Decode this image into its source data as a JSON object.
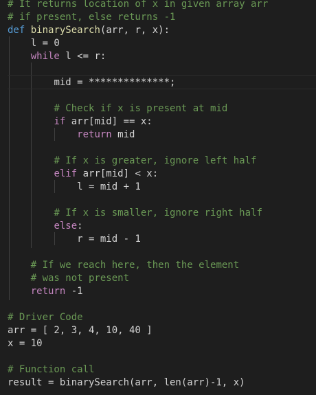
{
  "editor": {
    "lines": [
      {
        "c": "# It returns location of x in given array arr"
      },
      {
        "c": "# if present, else returns -1"
      },
      {
        "k": "def",
        "f": "binarySearch",
        "t": "(arr, r, x):"
      },
      {
        "t": "l = 0"
      },
      {
        "k": "while",
        "t": "l <= r:"
      },
      {
        "t": ""
      },
      {
        "t": "mid = **************;"
      },
      {
        "t": ""
      },
      {
        "c": "# Check if x is present at mid"
      },
      {
        "k": "if",
        "t": "arr[mid] == x:"
      },
      {
        "k": "return",
        "t": "mid"
      },
      {
        "t": ""
      },
      {
        "c": "# If x is greater, ignore left half"
      },
      {
        "k": "elif",
        "t": "arr[mid] < x:"
      },
      {
        "t": "l = mid + 1"
      },
      {
        "t": ""
      },
      {
        "c": "# If x is smaller, ignore right half"
      },
      {
        "k": "else",
        "t": ":"
      },
      {
        "t": "r = mid - 1"
      },
      {
        "t": ""
      },
      {
        "c": "# If we reach here, then the element"
      },
      {
        "c": "# was not present"
      },
      {
        "k": "return",
        "t": "-1"
      },
      {
        "t": ""
      },
      {
        "c": "# Driver Code"
      },
      {
        "t": "arr = [ 2, 3, 4, 10, 40 ]"
      },
      {
        "t": "x = 10"
      },
      {
        "t": ""
      },
      {
        "c": "# Function call"
      },
      {
        "t": "result = binarySearch(arr, len(arr)-1, x)"
      }
    ]
  },
  "colors": {
    "background": "#1e1e1e",
    "comment": "#6a9955",
    "keyword_control": "#c586c0",
    "keyword_def": "#569cd6",
    "function": "#dcdcaa",
    "text": "#d4d4d4"
  }
}
